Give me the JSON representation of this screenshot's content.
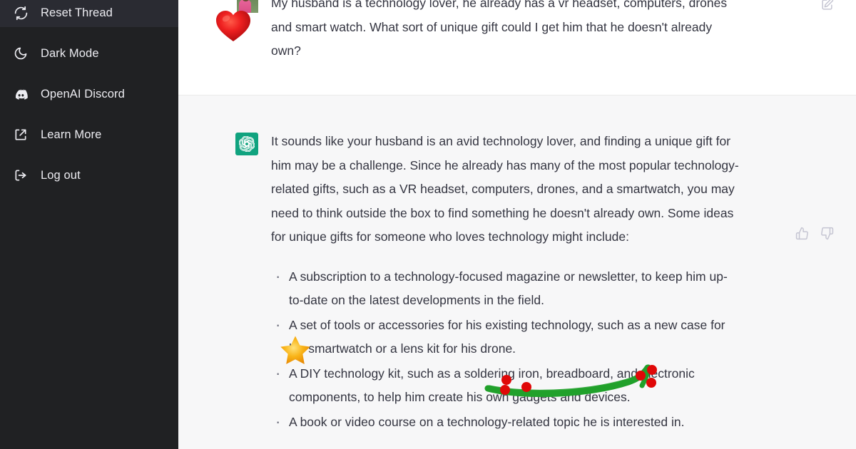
{
  "sidebar": {
    "background_color": "#202123",
    "items": [
      {
        "label": "Reset Thread",
        "icon": "reset-thread-icon"
      },
      {
        "label": "Dark Mode",
        "icon": "moon-icon"
      },
      {
        "label": "OpenAI Discord",
        "icon": "discord-icon"
      },
      {
        "label": "Learn More",
        "icon": "external-link-icon"
      },
      {
        "label": "Log out",
        "icon": "logout-icon"
      }
    ]
  },
  "conversation": {
    "user_message": {
      "avatar": "user-photo-avatar",
      "text": "My husband is a technology lover, he already has a vr headset, computers, drones and smart watch. What sort of unique gift could I get him that he doesn't already own?",
      "edit_icon": "edit-pencil-icon",
      "background_color": "#ffffff"
    },
    "assistant_message": {
      "avatar": "openai-logo-icon",
      "avatar_color": "#10a37f",
      "background_color": "#f7f7f8",
      "paragraph": "It sounds like your husband is an avid technology lover, and finding a unique gift for him may be a challenge. Since he already has many of the most popular technology-related gifts, such as a VR headset, computers, drones, and a smartwatch, you may need to think outside the box to find something he doesn't already own. Some ideas for unique gifts for someone who loves technology might include:",
      "bullets": [
        "A subscription to a technology-focused magazine or newsletter, to keep him up-to-date on the latest developments in the field.",
        "A set of tools or accessories for his existing technology, such as a new case for his smartwatch or a lens kit for his drone.",
        "A DIY technology kit, such as a soldering iron, breadboard, and electronic components, to help him create his own gadgets and devices.",
        "A book or video course on a technology-related topic he is interested in."
      ],
      "thumbs_up_icon": "thumbs-up-icon",
      "thumbs_down_icon": "thumbs-down-icon"
    }
  },
  "annotations": {
    "heart_sticker": {
      "name": "red-heart-emoji",
      "color": "#e8232a"
    },
    "star_sticker": {
      "name": "gold-star-emoji",
      "color": "#f5a623"
    },
    "green_stroke": {
      "name": "green-brush-underline",
      "stroke_color": "#21a12b",
      "handle_color": "#e00808",
      "handle_count": 5
    }
  }
}
